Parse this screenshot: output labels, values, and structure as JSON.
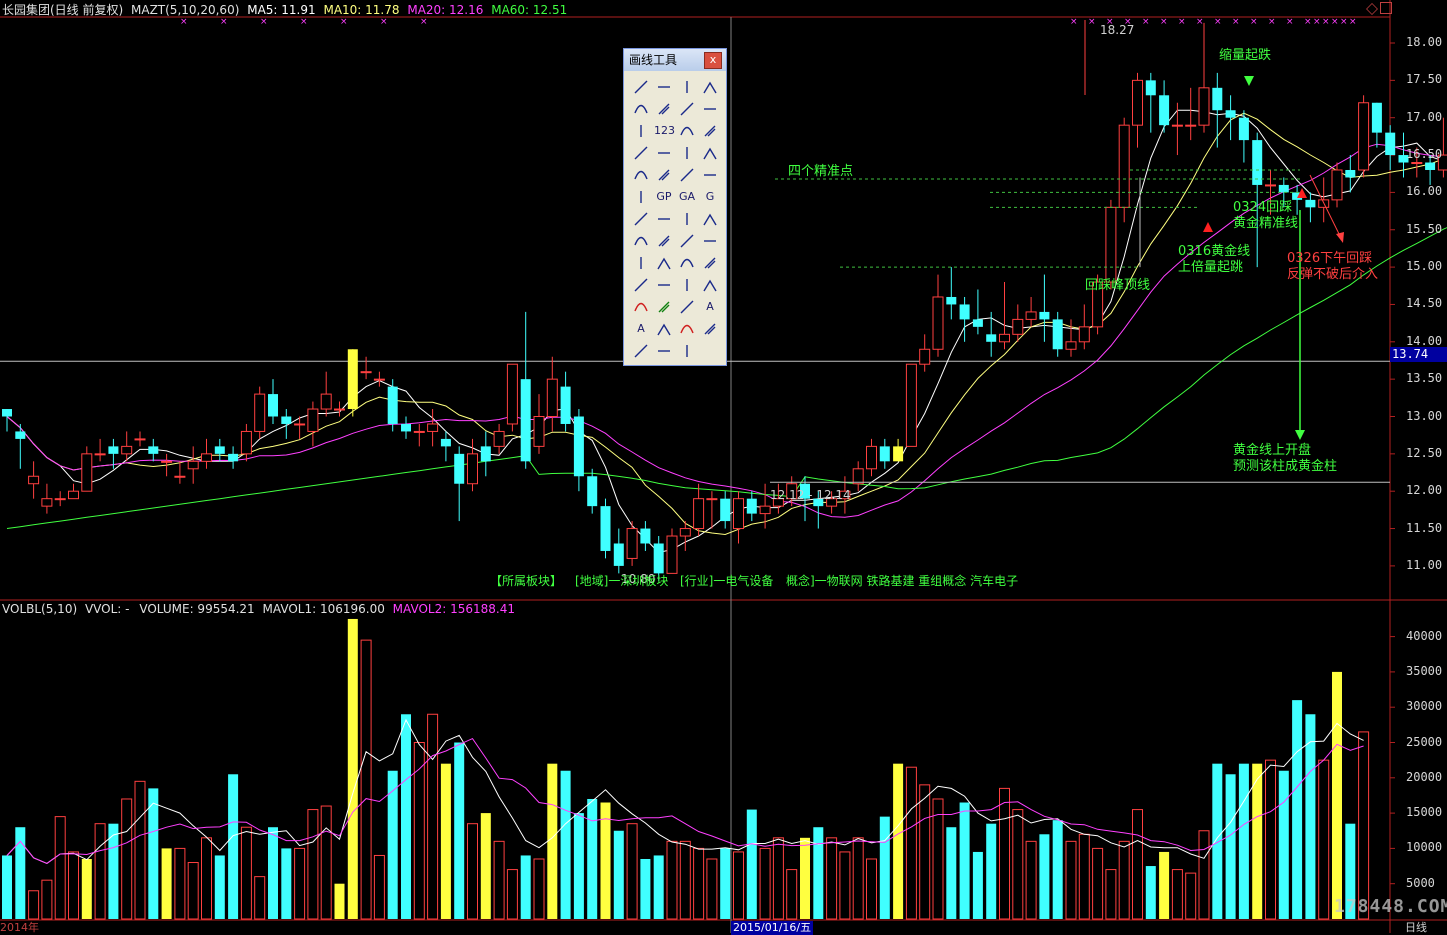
{
  "price_header": {
    "stock": "长园集团(日线 前复权)",
    "indicator": "MAZT(5,10,20,60)",
    "ma5": "MA5: 11.91",
    "ma10": "MA10: 11.78",
    "ma20": "MA20: 12.16",
    "ma60": "MA60: 12.51"
  },
  "volume_header": {
    "indicator": "VOLBL(5,10)",
    "vvol": "VVOL: -",
    "volume": "VOLUME: 99554.21",
    "mavol1": "MAVOL1: 106196.00",
    "mavol2": "MAVOL2: 156188.41"
  },
  "price_axis": [
    "18.00",
    "17.50",
    "17.00",
    "16.50",
    "16.00",
    "15.50",
    "15.00",
    "14.50",
    "14.00",
    "13.50",
    "13.00",
    "12.50",
    "12.00",
    "11.50",
    "11.00"
  ],
  "volume_axis": [
    "40000",
    "35000",
    "30000",
    "25000",
    "20000",
    "15000",
    "10000",
    "5000"
  ],
  "current_price_label": "13.74",
  "high_label": "18.27",
  "low_label": "10.80",
  "hline_label": "12.12 - 12.14",
  "annotations": {
    "shrink_rise": "缩量起跌",
    "four_points": "四个精准点",
    "a0324_line1": "0324回踩",
    "a0324_line2": "黄金精准线",
    "a0316_line1": "0316黄金线",
    "a0316_line2": "上倍量起跳",
    "a0326_line1": "0326下午回踩",
    "a0326_line2": "反弹不破后介入",
    "peak_line": "回踩峰顶线",
    "gold_open_1": "黄金线上开盘",
    "gold_open_2": "预测该柱成黄金柱"
  },
  "sector_info": {
    "board": "【所属板块】",
    "region": "[地域]一深圳板块",
    "industry": "[行业]一电气设备",
    "concept": "概念]一物联网 铁路基建 重组概念 汽车电子"
  },
  "palette": {
    "title": "画线工具",
    "close": "x",
    "tools": [
      "arrow-select",
      "segment",
      "ray",
      "line",
      "trend-h",
      "h-ray",
      "v-line",
      "dot-seg",
      "v-line2",
      "num-123",
      "parallel",
      "parallel2",
      "arc-tool",
      "arc",
      "circle",
      "sphere",
      "wave-w",
      "wave",
      "wave-up",
      "wave-n",
      "wave-m",
      "fibo-gp",
      "fibo-ga",
      "fibo-gt",
      "fibo-lines",
      "fibo-time",
      "gann",
      "gann2",
      "cycle",
      "cycle2",
      "cycle3",
      "cycle4",
      "cycle5",
      "cycle6",
      "cycle7",
      "angle",
      "fan",
      "down-arrow",
      "triangle",
      "rect",
      "up-red",
      "down-green",
      "arrow-mix",
      "text-A",
      "text-tag",
      "box",
      "delete",
      "lock",
      "note",
      "ruler",
      "camera"
    ],
    "tool_labels": {
      "num-123": "123",
      "fibo-gp": "GP",
      "fibo-ga": "GA",
      "fibo-gt": "G",
      "text-A": "A",
      "text-tag": "A"
    }
  },
  "footer": {
    "date_label": "2015/01/16/五",
    "period": "日线",
    "watermark": "178448.COM",
    "year_left": "2014年"
  },
  "chart_data": {
    "type": "candlestick",
    "panels": [
      "price",
      "volume"
    ],
    "price_ylim": [
      10.7,
      18.3
    ],
    "volume_ylim": [
      0,
      44000
    ],
    "candles": [
      [
        13.1,
        13.0,
        12.8,
        13.1
      ],
      [
        12.8,
        12.7,
        12.3,
        12.9
      ],
      [
        12.1,
        12.2,
        11.9,
        12.4
      ],
      [
        11.8,
        11.9,
        11.7,
        12.1
      ],
      [
        11.9,
        11.9,
        11.8,
        12.0
      ],
      [
        11.9,
        12.0,
        11.9,
        12.1
      ],
      [
        12.0,
        12.5,
        12.0,
        12.6
      ],
      [
        12.5,
        12.5,
        12.4,
        12.7
      ],
      [
        12.6,
        12.5,
        12.3,
        12.7
      ],
      [
        12.5,
        12.6,
        12.4,
        12.8
      ],
      [
        12.7,
        12.7,
        12.6,
        12.8
      ],
      [
        12.6,
        12.5,
        12.4,
        12.7
      ],
      [
        12.4,
        12.4,
        12.2,
        12.5
      ],
      [
        12.2,
        12.2,
        12.1,
        12.4
      ],
      [
        12.3,
        12.4,
        12.1,
        12.6
      ],
      [
        12.4,
        12.5,
        12.3,
        12.7
      ],
      [
        12.6,
        12.5,
        12.4,
        12.7
      ],
      [
        12.5,
        12.4,
        12.3,
        12.6
      ],
      [
        12.5,
        12.8,
        12.4,
        12.9
      ],
      [
        12.8,
        13.3,
        12.7,
        13.4
      ],
      [
        13.3,
        13.0,
        12.9,
        13.5
      ],
      [
        13.0,
        12.9,
        12.7,
        13.1
      ],
      [
        12.9,
        12.9,
        12.7,
        13.0
      ],
      [
        12.8,
        13.1,
        12.6,
        13.2
      ],
      [
        13.1,
        13.3,
        13.0,
        13.6
      ],
      [
        13.1,
        13.1,
        13.0,
        13.2
      ],
      [
        13.1,
        13.9,
        13.0,
        13.9
      ],
      [
        13.6,
        13.6,
        13.5,
        13.8
      ],
      [
        13.5,
        13.5,
        13.4,
        13.6
      ],
      [
        13.4,
        12.9,
        12.8,
        13.5
      ],
      [
        12.9,
        12.8,
        12.7,
        13.0
      ],
      [
        12.8,
        12.8,
        12.6,
        12.9
      ],
      [
        12.8,
        12.9,
        12.6,
        13.1
      ],
      [
        12.7,
        12.6,
        12.4,
        12.8
      ],
      [
        12.5,
        12.1,
        11.6,
        12.6
      ],
      [
        12.1,
        12.5,
        12.0,
        12.7
      ],
      [
        12.6,
        12.4,
        12.2,
        12.8
      ],
      [
        12.6,
        12.8,
        12.5,
        12.9
      ],
      [
        12.9,
        13.7,
        12.8,
        13.7
      ],
      [
        13.5,
        12.4,
        12.3,
        14.4
      ],
      [
        12.6,
        13.0,
        12.5,
        13.3
      ],
      [
        13.0,
        13.5,
        12.8,
        13.8
      ],
      [
        13.4,
        12.9,
        12.8,
        13.6
      ],
      [
        13.0,
        12.2,
        12.0,
        13.1
      ],
      [
        12.2,
        11.8,
        11.7,
        12.3
      ],
      [
        11.8,
        11.2,
        11.1,
        11.9
      ],
      [
        11.3,
        11.0,
        10.9,
        11.5
      ],
      [
        11.1,
        11.5,
        11.0,
        11.6
      ],
      [
        11.5,
        11.3,
        11.2,
        11.6
      ],
      [
        11.3,
        10.9,
        10.8,
        11.4
      ],
      [
        10.9,
        11.4,
        10.9,
        11.5
      ],
      [
        11.4,
        11.5,
        11.2,
        11.6
      ],
      [
        11.5,
        11.9,
        11.4,
        12.1
      ],
      [
        11.9,
        11.9,
        11.5,
        12.0
      ],
      [
        11.9,
        11.6,
        11.5,
        12.0
      ],
      [
        11.5,
        11.9,
        11.3,
        12.0
      ],
      [
        11.9,
        11.7,
        11.6,
        12.0
      ],
      [
        11.7,
        11.8,
        11.5,
        12.1
      ],
      [
        11.8,
        11.9,
        11.7,
        12.1
      ],
      [
        11.9,
        12.1,
        11.8,
        12.2
      ],
      [
        12.1,
        11.9,
        11.6,
        12.2
      ],
      [
        11.9,
        11.8,
        11.5,
        12.0
      ],
      [
        11.8,
        11.9,
        11.7,
        12.0
      ],
      [
        11.9,
        12.0,
        11.7,
        12.2
      ],
      [
        12.1,
        12.3,
        12.0,
        12.4
      ],
      [
        12.3,
        12.6,
        12.2,
        12.7
      ],
      [
        12.6,
        12.4,
        12.3,
        12.7
      ],
      [
        12.4,
        12.6,
        12.4,
        12.7
      ],
      [
        12.6,
        13.7,
        12.6,
        13.7
      ],
      [
        13.7,
        13.9,
        13.6,
        14.1
      ],
      [
        13.9,
        14.6,
        13.8,
        14.9
      ],
      [
        14.6,
        14.5,
        14.3,
        15.0
      ],
      [
        14.5,
        14.3,
        14.0,
        14.6
      ],
      [
        14.3,
        14.2,
        14.1,
        14.7
      ],
      [
        14.1,
        14.0,
        13.8,
        14.4
      ],
      [
        14.0,
        14.1,
        13.9,
        14.8
      ],
      [
        14.1,
        14.3,
        14.0,
        14.5
      ],
      [
        14.3,
        14.4,
        14.2,
        14.6
      ],
      [
        14.4,
        14.3,
        14.0,
        14.9
      ],
      [
        14.3,
        13.9,
        13.8,
        14.4
      ],
      [
        13.9,
        14.0,
        13.8,
        14.3
      ],
      [
        14.0,
        14.2,
        13.9,
        14.5
      ],
      [
        14.2,
        14.8,
        14.1,
        14.9
      ],
      [
        14.8,
        15.8,
        14.7,
        15.9
      ],
      [
        15.8,
        16.9,
        15.6,
        17.0
      ],
      [
        16.9,
        17.5,
        16.6,
        17.6
      ],
      [
        17.5,
        17.3,
        16.8,
        17.6
      ],
      [
        17.3,
        16.9,
        16.8,
        17.5
      ],
      [
        16.9,
        16.9,
        16.5,
        17.2
      ],
      [
        16.9,
        16.9,
        16.7,
        17.4
      ],
      [
        16.9,
        17.4,
        16.8,
        18.27
      ],
      [
        17.4,
        17.1,
        16.6,
        17.6
      ],
      [
        17.1,
        17.0,
        16.7,
        17.3
      ],
      [
        17.0,
        16.7,
        16.4,
        17.1
      ],
      [
        16.7,
        16.1,
        15.0,
        16.8
      ],
      [
        16.1,
        16.1,
        15.7,
        16.3
      ],
      [
        16.1,
        16.0,
        15.8,
        16.2
      ],
      [
        16.0,
        15.9,
        15.7,
        16.1
      ],
      [
        15.9,
        15.8,
        15.6,
        16.0
      ],
      [
        15.8,
        15.9,
        15.6,
        16.2
      ],
      [
        15.9,
        16.3,
        15.8,
        16.4
      ],
      [
        16.3,
        16.2,
        16.0,
        16.5
      ],
      [
        16.3,
        17.2,
        16.2,
        17.3
      ],
      [
        17.2,
        16.8,
        16.6,
        17.2
      ],
      [
        16.8,
        16.5,
        16.3,
        16.9
      ],
      [
        16.5,
        16.4,
        16.2,
        16.8
      ],
      [
        16.4,
        16.4,
        16.2,
        16.6
      ],
      [
        16.4,
        16.3,
        16.1,
        16.5
      ],
      [
        16.3,
        16.5,
        16.2,
        17.0
      ],
      [
        16.5,
        16.9,
        16.4,
        17.1
      ],
      [
        16.9,
        16.5,
        16.4,
        17.0
      ],
      [
        16.5,
        16.5,
        16.4,
        16.8
      ],
      [
        16.5,
        17.2,
        16.5,
        18.1
      ]
    ],
    "volumes": [
      9000,
      13000,
      4000,
      5500,
      14500,
      9500,
      8500,
      13500,
      13500,
      17000,
      19500,
      18500,
      10000,
      10000,
      8000,
      11500,
      9000,
      20500,
      13000,
      6000,
      13000,
      10000,
      10000,
      15500,
      16000,
      5000,
      42500,
      39500,
      9000,
      21000,
      29000,
      25000,
      29000,
      22000,
      25000,
      13500,
      15000,
      11000,
      7000,
      9000,
      8500,
      22000,
      21000,
      15000,
      17000,
      16500,
      12500,
      13500,
      8500,
      9000,
      11000,
      11000,
      10000,
      8500,
      10000,
      9500,
      15500,
      10000,
      11500,
      7000,
      11500,
      13000,
      11500,
      9500,
      11500,
      8500,
      14500,
      22000,
      21500,
      19000,
      17000,
      13000,
      16500,
      9500,
      13500,
      18500,
      15500,
      11000,
      12000,
      14000,
      11000,
      12000,
      10000,
      7000,
      11000,
      15500,
      7500,
      9500,
      7000,
      6500,
      12500,
      22000,
      20500,
      22000,
      22000,
      22500,
      21000,
      31000,
      29000,
      22500,
      35000,
      13500,
      26500
    ],
    "ma_colors": {
      "ma5": "#ffffff",
      "ma10": "#ffff80",
      "ma20": "#ff40ff",
      "ma60": "#40ff40"
    },
    "up_color": "#ff4040",
    "down_color": "#40ffff",
    "highlight_color": "#ffff40"
  }
}
